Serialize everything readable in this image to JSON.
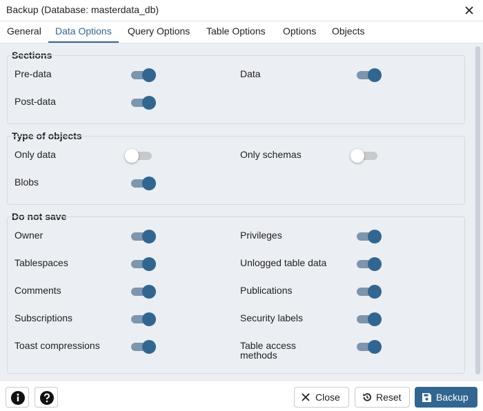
{
  "dialog": {
    "title": "Backup (Database: masterdata_db)"
  },
  "tabs": [
    {
      "label": "General"
    },
    {
      "label": "Data Options"
    },
    {
      "label": "Query Options"
    },
    {
      "label": "Table Options"
    },
    {
      "label": "Options"
    },
    {
      "label": "Objects"
    }
  ],
  "active_tab": "Data Options",
  "sections": [
    {
      "title": "Sections",
      "options": [
        {
          "label": "Pre-data",
          "on": true
        },
        {
          "label": "Data",
          "on": true
        },
        {
          "label": "Post-data",
          "on": true
        }
      ]
    },
    {
      "title": "Type of objects",
      "options": [
        {
          "label": "Only data",
          "on": false
        },
        {
          "label": "Only schemas",
          "on": false
        },
        {
          "label": "Blobs",
          "on": true
        }
      ]
    },
    {
      "title": "Do not save",
      "options": [
        {
          "label": "Owner",
          "on": true
        },
        {
          "label": "Privileges",
          "on": true
        },
        {
          "label": "Tablespaces",
          "on": true
        },
        {
          "label": "Unlogged table data",
          "on": true
        },
        {
          "label": "Comments",
          "on": true
        },
        {
          "label": "Publications",
          "on": true
        },
        {
          "label": "Subscriptions",
          "on": true
        },
        {
          "label": "Security labels",
          "on": true
        },
        {
          "label": "Toast compressions",
          "on": true
        },
        {
          "label": "Table access methods",
          "on": true
        }
      ]
    }
  ],
  "footer": {
    "close_label": "Close",
    "reset_label": "Reset",
    "backup_label": "Backup"
  },
  "colors": {
    "accent": "#326690",
    "toggle_on_track": "#7d95ad",
    "toggle_off_track": "#c7c9cd",
    "panel_bg": "#ebeef3"
  }
}
